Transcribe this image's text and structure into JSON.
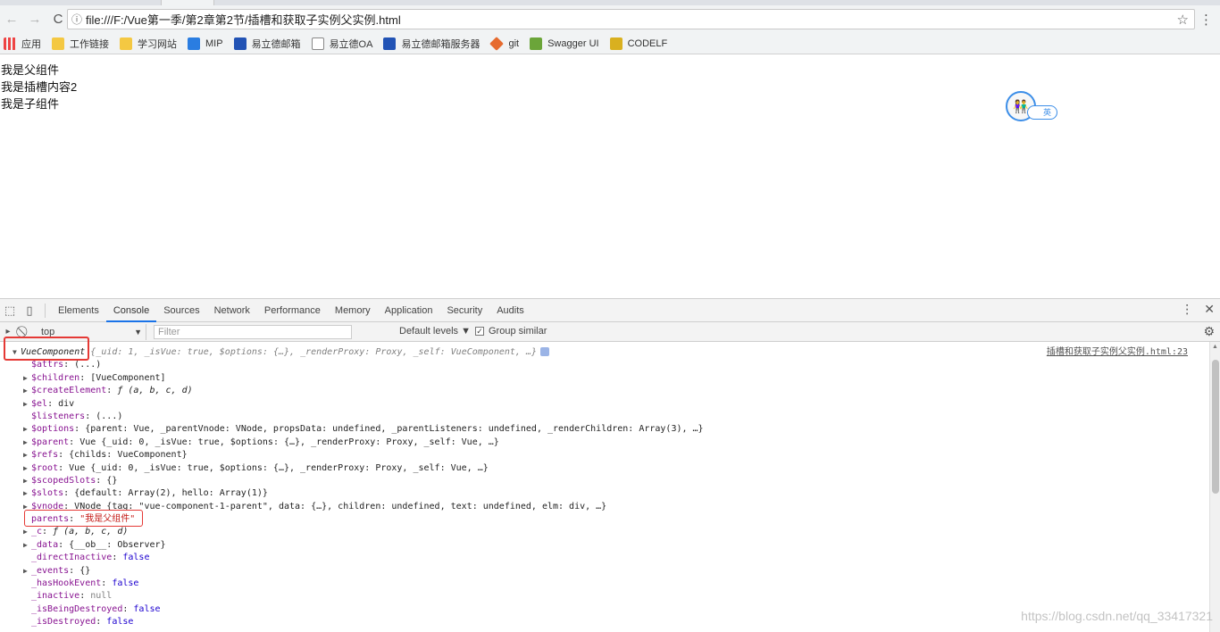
{
  "browser": {
    "url": "file:///F:/Vue第一季/第2章第2节/插槽和获取子实例父实例.html",
    "back_icon": "←",
    "forward_icon": "→",
    "reload_icon": "C",
    "info_icon": "ⓘ",
    "star_icon": "☆",
    "menu_icon": "⋮"
  },
  "bookmarks": [
    {
      "label": "应用",
      "icon": "apps-icon"
    },
    {
      "label": "工作链接",
      "icon": "folder-icon"
    },
    {
      "label": "学习网站",
      "icon": "folder-icon"
    },
    {
      "label": "MIP",
      "icon": "mip-icon"
    },
    {
      "label": "易立德邮箱",
      "icon": "u-icon"
    },
    {
      "label": "易立德OA",
      "icon": "doc-icon"
    },
    {
      "label": "易立德邮箱服务器",
      "icon": "u-icon"
    },
    {
      "label": "git",
      "icon": "gitlab-icon"
    },
    {
      "label": "Swagger UI",
      "icon": "swagger-icon"
    },
    {
      "label": "CODELF",
      "icon": "codelf-icon"
    }
  ],
  "page": {
    "lines": [
      "我是父组件",
      "我是插槽内容2",
      "我是子组件"
    ],
    "widget_pill": "英"
  },
  "devtools": {
    "tabs": [
      "Elements",
      "Console",
      "Sources",
      "Network",
      "Performance",
      "Memory",
      "Application",
      "Security",
      "Audits"
    ],
    "active_tab": "Console",
    "context": "top",
    "filter_placeholder": "Filter",
    "levels": "Default levels ▼",
    "group_similar": "Group similar",
    "group_similar_checked": true,
    "close_icon": "✕",
    "more_icon": "⋮",
    "source_link": "插槽和获取子实例父实例.html:23",
    "top_entry": {
      "name": "VueComponent",
      "preview": "{_uid: 1, _isVue: true, $options: {…}, _renderProxy: Proxy, _self: VueComponent, …}"
    },
    "props": [
      {
        "expand": false,
        "key": "$attrs",
        "val": "(...)"
      },
      {
        "expand": true,
        "key": "$children",
        "val": "[VueComponent]"
      },
      {
        "expand": true,
        "key": "$createElement",
        "val": "ƒ (a, b, c, d)"
      },
      {
        "expand": true,
        "key": "$el",
        "val": "div"
      },
      {
        "expand": false,
        "key": "$listeners",
        "val": "(...)"
      },
      {
        "expand": true,
        "key": "$options",
        "val": "{parent: Vue, _parentVnode: VNode, propsData: undefined, _parentListeners: undefined, _renderChildren: Array(3), …}"
      },
      {
        "expand": true,
        "key": "$parent",
        "val": "Vue {_uid: 0, _isVue: true, $options: {…}, _renderProxy: Proxy, _self: Vue, …}"
      },
      {
        "expand": true,
        "key": "$refs",
        "val": "{childs: VueComponent}"
      },
      {
        "expand": true,
        "key": "$root",
        "val": "Vue {_uid: 0, _isVue: true, $options: {…}, _renderProxy: Proxy, _self: Vue, …}"
      },
      {
        "expand": true,
        "key": "$scopedSlots",
        "val": "{}"
      },
      {
        "expand": true,
        "key": "$slots",
        "val": "{default: Array(2), hello: Array(1)}"
      },
      {
        "expand": true,
        "key": "$vnode",
        "val": "VNode {tag: \"vue-component-1-parent\", data: {…}, children: undefined, text: undefined, elm: div, …}"
      },
      {
        "expand": false,
        "key": "parents",
        "val": "\"我是父组件\""
      },
      {
        "expand": true,
        "key": "_c",
        "val": "ƒ (a, b, c, d)"
      },
      {
        "expand": true,
        "key": "_data",
        "val": "{__ob__: Observer}"
      },
      {
        "expand": false,
        "key": "_directInactive",
        "val": "false"
      },
      {
        "expand": true,
        "key": "_events",
        "val": "{}"
      },
      {
        "expand": false,
        "key": "_hasHookEvent",
        "val": "false"
      },
      {
        "expand": false,
        "key": "_inactive",
        "val": "null"
      },
      {
        "expand": false,
        "key": "_isBeingDestroyed",
        "val": "false"
      },
      {
        "expand": false,
        "key": "_isDestroyed",
        "val": "false"
      }
    ]
  },
  "watermark": "https://blog.csdn.net/qq_33417321"
}
